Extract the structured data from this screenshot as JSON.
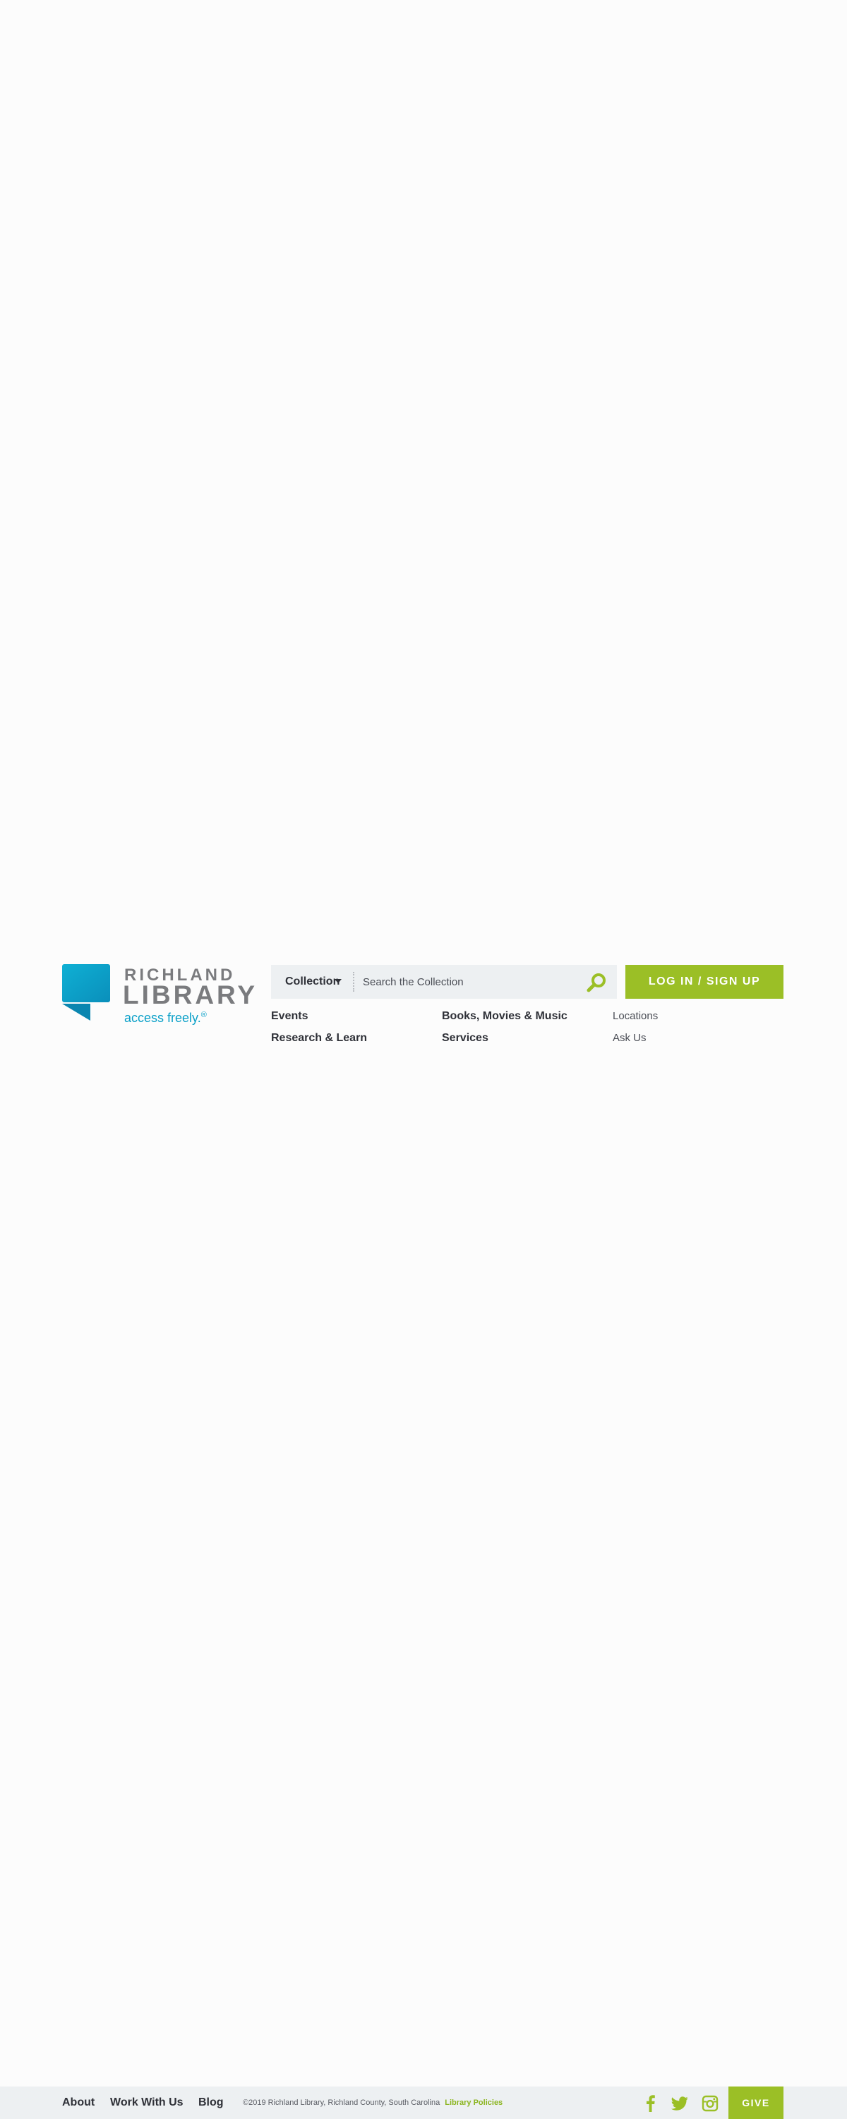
{
  "colors": {
    "brand_blue": "#0aa0c8",
    "brand_green": "#9bbf26",
    "text_dark": "#2f3138",
    "search_bg": "#edf0f2"
  },
  "logo": {
    "word_top": "RICHLAND",
    "word_bottom": "LIBRARY",
    "tagline": "access freely.",
    "tagline_mark": "®",
    "icon": "speech-bubble-logo-icon"
  },
  "search": {
    "scope_label": "Collection",
    "placeholder": "Search the Collection",
    "value": "",
    "submit_icon": "search-icon"
  },
  "account": {
    "login_label": "LOG IN / SIGN UP"
  },
  "nav": {
    "primary": [
      {
        "label": "Events"
      },
      {
        "label": "Books, Movies & Music"
      },
      {
        "label": "Research & Learn"
      },
      {
        "label": "Services"
      }
    ],
    "secondary": [
      {
        "label": "Locations"
      },
      {
        "label": "Ask Us"
      }
    ]
  },
  "footer": {
    "links": [
      {
        "label": "About"
      },
      {
        "label": "Work With Us"
      },
      {
        "label": "Blog"
      }
    ],
    "copyright": "©2019 Richland Library, Richland County, South Carolina",
    "policies_label": "Library Policies",
    "social": [
      {
        "icon": "facebook-icon"
      },
      {
        "icon": "twitter-icon"
      },
      {
        "icon": "instagram-icon"
      }
    ],
    "give_label": "GIVE"
  }
}
